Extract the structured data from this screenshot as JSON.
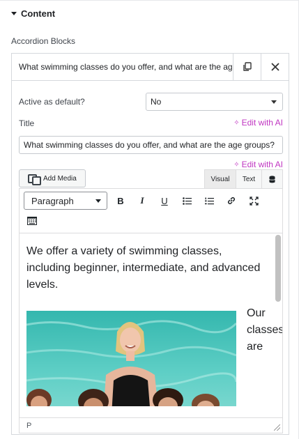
{
  "section": {
    "title": "Content"
  },
  "repeater": {
    "label": "Accordion Blocks",
    "item_title": "What swimming classes do you offer, and what are the age groups?"
  },
  "fields": {
    "active_default_label": "Active as default?",
    "active_default_value": "No",
    "title_label": "Title",
    "title_value": "What swimming classes do you offer, and what are the age groups?",
    "edit_ai_label": "Edit with AI"
  },
  "editor": {
    "add_media_label": "Add Media",
    "tab_visual": "Visual",
    "tab_text": "Text",
    "format_value": "Paragraph",
    "content_paragraph": "We offer a variety of swimming classes, including beginner, intermediate, and advanced levels.",
    "wrap_text": "Our classes are",
    "status_path": "P"
  },
  "colors": {
    "ai_accent": "#c036c2",
    "border": "#d5d8dc"
  },
  "icons": {
    "duplicate": "copy-icon",
    "remove": "close-icon",
    "add_media": "media-icon",
    "code_view": "database-icon",
    "bold": "bold-icon",
    "italic": "italic-icon",
    "underline": "underline-icon",
    "bullet_list": "bullet-list-icon",
    "numbered_list": "numbered-list-icon",
    "link": "link-icon",
    "fullscreen": "fullscreen-icon",
    "toolbar_toggle": "toolbar-toggle-icon"
  }
}
